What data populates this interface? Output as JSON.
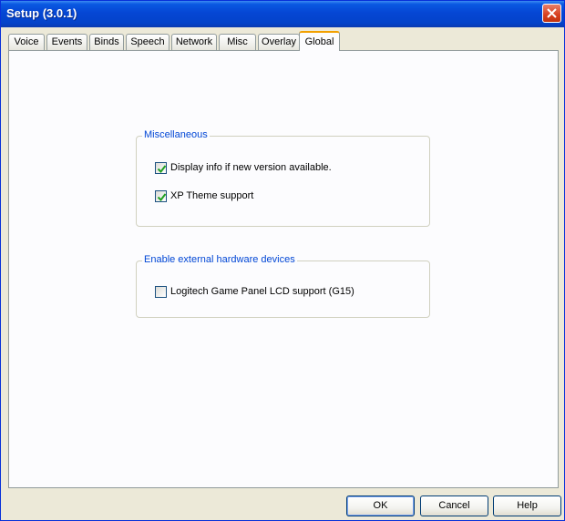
{
  "window": {
    "title": "Setup (3.0.1)"
  },
  "tabs": [
    {
      "label": "Voice"
    },
    {
      "label": "Events"
    },
    {
      "label": "Binds"
    },
    {
      "label": "Speech"
    },
    {
      "label": "Network"
    },
    {
      "label": "Misc"
    },
    {
      "label": "Overlay"
    },
    {
      "label": "Global",
      "active": true
    }
  ],
  "groups": {
    "miscellaneous": {
      "title": "Miscellaneous",
      "options": [
        {
          "label": "Display info if new version available.",
          "checked": true
        },
        {
          "label": "XP Theme support",
          "checked": true
        }
      ]
    },
    "hardware": {
      "title": "Enable external hardware devices",
      "options": [
        {
          "label": "Logitech Game Panel LCD support (G15)",
          "checked": false
        }
      ]
    }
  },
  "buttons": {
    "ok": "OK",
    "cancel": "Cancel",
    "help": "Help"
  },
  "colors": {
    "titlebar": "#0546d4",
    "group_title": "#0046d5",
    "active_tab_accent": "#f2a000",
    "checkmark": "#21a121"
  }
}
